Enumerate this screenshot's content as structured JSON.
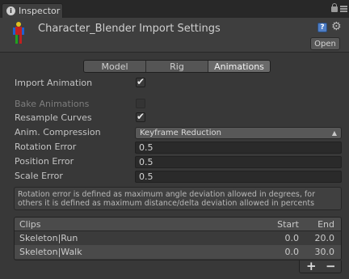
{
  "window": {
    "tab_label": "Inspector",
    "tab_icon": "i"
  },
  "header": {
    "title": "Character_Blender Import Settings",
    "help_glyph": "?",
    "open_label": "Open"
  },
  "tabs": [
    {
      "label": "Model",
      "active": false
    },
    {
      "label": "Rig",
      "active": false
    },
    {
      "label": "Animations",
      "active": true
    }
  ],
  "settings": {
    "import_animation": {
      "label": "Import Animation",
      "checked": true
    },
    "bake_animations": {
      "label": "Bake Animations",
      "checked": false,
      "disabled": true
    },
    "resample_curves": {
      "label": "Resample Curves",
      "checked": true
    },
    "anim_compression": {
      "label": "Anim. Compression",
      "value": "Keyframe Reduction"
    },
    "rotation_error": {
      "label": "Rotation Error",
      "value": "0.5"
    },
    "position_error": {
      "label": "Position Error",
      "value": "0.5"
    },
    "scale_error": {
      "label": "Scale Error",
      "value": "0.5"
    }
  },
  "info": {
    "line1": "Rotation error is defined as maximum angle deviation allowed in degrees, for",
    "line2": "others it is defined as maximum distance/delta deviation allowed in percents"
  },
  "clips": {
    "headers": {
      "name": "Clips",
      "start": "Start",
      "end": "End"
    },
    "rows": [
      {
        "name": "Skeleton|Run",
        "start": "0.0",
        "end": "20.0"
      },
      {
        "name": "Skeleton|Walk",
        "start": "0.0",
        "end": "30.0"
      }
    ],
    "add_label": "+",
    "remove_label": "−"
  },
  "colors": {
    "background": "#383838",
    "active_tab": "#6a6a6a",
    "help_icon": "#4f7ec5"
  }
}
